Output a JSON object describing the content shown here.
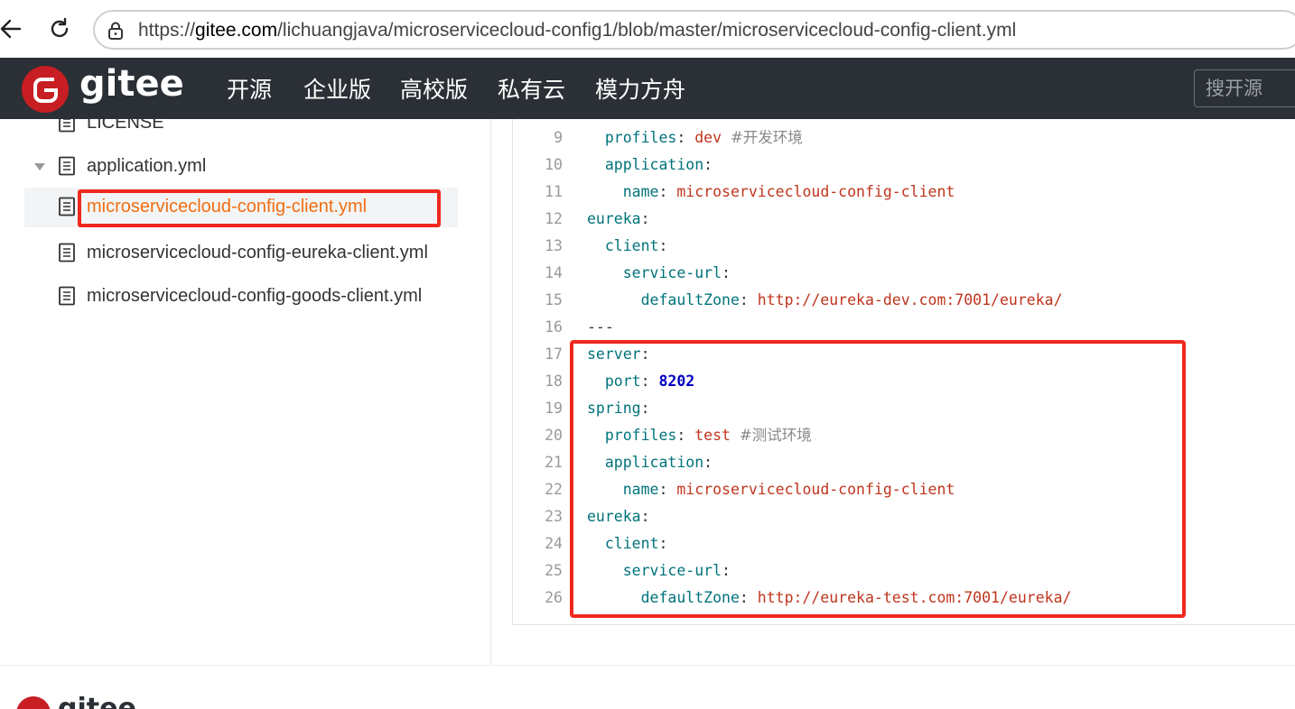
{
  "browser": {
    "url_prefix": "https://",
    "url_host": "gitee.com",
    "url_path": "/lichuangjava/microservicecloud-config1/blob/master/microservicecloud-config-client.yml"
  },
  "header": {
    "logo_text": "gitee",
    "nav": [
      "开源",
      "企业版",
      "高校版",
      "私有云",
      "模力方舟"
    ],
    "search_placeholder": "搜开源"
  },
  "sidebar": {
    "items": [
      {
        "label": "LICENSE"
      },
      {
        "label": "application.yml"
      },
      {
        "label": "microservicecloud-config-client.yml"
      },
      {
        "label": "microservicecloud-config-eureka-client.yml"
      },
      {
        "label": "microservicecloud-config-goods-client.yml"
      }
    ]
  },
  "code": {
    "lines": [
      {
        "n": "9",
        "indent": "  ",
        "key": "profiles",
        "val": "dev",
        "comment": "#开发环境"
      },
      {
        "n": "10",
        "indent": "  ",
        "key": "application",
        "val": "",
        "comment": ""
      },
      {
        "n": "11",
        "indent": "    ",
        "key": "name",
        "val": "microservicecloud-config-client",
        "comment": ""
      },
      {
        "n": "12",
        "indent": "",
        "key": "eureka",
        "val": "",
        "comment": ""
      },
      {
        "n": "13",
        "indent": "  ",
        "key": "client",
        "val": "",
        "comment": ""
      },
      {
        "n": "14",
        "indent": "    ",
        "key": "service-url",
        "val": "",
        "comment": ""
      },
      {
        "n": "15",
        "indent": "      ",
        "key": "defaultZone",
        "val": "http://eureka-dev.com:7001/eureka/",
        "comment": ""
      },
      {
        "n": "16",
        "indent": "",
        "key": "",
        "val": "",
        "comment": "",
        "raw": "---"
      },
      {
        "n": "17",
        "indent": "",
        "key": "server",
        "val": "",
        "comment": ""
      },
      {
        "n": "18",
        "indent": "  ",
        "key": "port",
        "val": "8202",
        "num": true,
        "comment": ""
      },
      {
        "n": "19",
        "indent": "",
        "key": "spring",
        "val": "",
        "comment": ""
      },
      {
        "n": "20",
        "indent": "  ",
        "key": "profiles",
        "val": "test",
        "comment": "#测试环境"
      },
      {
        "n": "21",
        "indent": "  ",
        "key": "application",
        "val": "",
        "comment": ""
      },
      {
        "n": "22",
        "indent": "    ",
        "key": "name",
        "val": "microservicecloud-config-client",
        "comment": ""
      },
      {
        "n": "23",
        "indent": "",
        "key": "eureka",
        "val": "",
        "comment": ""
      },
      {
        "n": "24",
        "indent": "  ",
        "key": "client",
        "val": "",
        "comment": ""
      },
      {
        "n": "25",
        "indent": "    ",
        "key": "service-url",
        "val": "",
        "comment": ""
      },
      {
        "n": "26",
        "indent": "      ",
        "key": "defaultZone",
        "val": "http://eureka-test.com:7001/eureka/",
        "comment": ""
      }
    ]
  },
  "footer": {
    "logo_text": "gitee"
  },
  "colors": {
    "brand_red": "#c71d23",
    "header_bg": "#2b3036",
    "active_file": "#f06e12",
    "highlight": "#f0281e"
  }
}
